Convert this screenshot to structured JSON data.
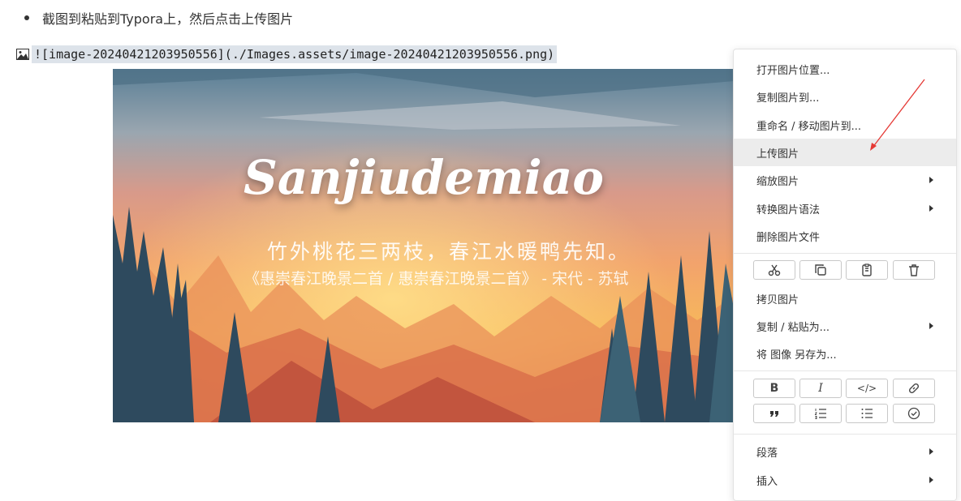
{
  "doc": {
    "bullet_text": "截图到粘贴到Typora上，然后点击上传图片",
    "image_markdown": "![image-20240421203950556](./Images.assets/image-20240421203950556.png)"
  },
  "image": {
    "title": "Sanjiudemiao",
    "poem": "竹外桃花三两枝，春江水暖鸭先知。",
    "source": "《惠崇春江晚景二首 / 惠崇春江晚景二首》 - 宋代 - 苏轼"
  },
  "context_menu": {
    "items_top": [
      {
        "label": "打开图片位置..."
      },
      {
        "label": "复制图片到..."
      },
      {
        "label": "重命名 / 移动图片到..."
      },
      {
        "label": "上传图片",
        "highlighted": true
      },
      {
        "label": "缩放图片",
        "submenu": true
      },
      {
        "label": "转换图片语法",
        "submenu": true
      },
      {
        "label": "删除图片文件"
      }
    ],
    "edit_buttons": [
      "cut-icon",
      "copy-icon",
      "paste-icon",
      "delete-icon"
    ],
    "items_mid": [
      {
        "label": "拷贝图片"
      },
      {
        "label": "复制 / 粘贴为...",
        "submenu": true
      },
      {
        "label": "将 图像 另存为..."
      }
    ],
    "format_buttons_row1": [
      "B",
      "I",
      "</>",
      "link-icon"
    ],
    "format_buttons_row2": [
      "quote-icon",
      "ordered-list-icon",
      "unordered-list-icon",
      "task-list-icon"
    ],
    "items_bottom": [
      {
        "label": "段落",
        "submenu": true
      },
      {
        "label": "插入",
        "submenu": true
      }
    ]
  },
  "colors": {
    "highlight": "#ececec",
    "annotation_arrow": "#e53935"
  }
}
